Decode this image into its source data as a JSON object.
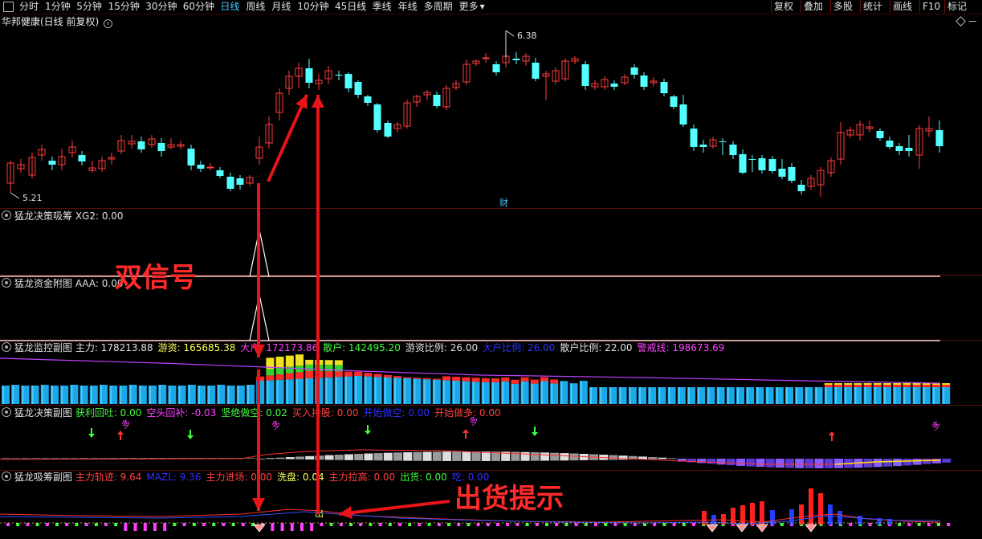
{
  "toolbar": {
    "left_tabs": [
      "分时",
      "1分钟",
      "5分钟",
      "15分钟",
      "30分钟",
      "60分钟",
      "日线",
      "周线",
      "月线",
      "10分钟",
      "45日线",
      "季线",
      "年线",
      "多周期",
      "更多"
    ],
    "active_tab": "日线",
    "right_buttons": [
      "复权",
      "叠加",
      "多股",
      "统计",
      "画线",
      "F10",
      "标记"
    ]
  },
  "main_panel": {
    "title": "华邦健康(日线 前复权)",
    "high_label": "6.38",
    "low_label": "5.21",
    "fin_marker": "财"
  },
  "panels": {
    "p1": {
      "name": "猛龙决策吸筹",
      "items": [
        {
          "label": "XG2:",
          "value": "0.00",
          "color": "#e0e0e0"
        }
      ]
    },
    "p2": {
      "name": "猛龙资金附图",
      "items": [
        {
          "label": "AAA:",
          "value": "0.00",
          "color": "#e0e0e0"
        }
      ]
    },
    "p3": {
      "name": "猛龙监控副图",
      "items": [
        {
          "label": "主力:",
          "value": "178213.88",
          "color": "#e0e0e0"
        },
        {
          "label": "游资:",
          "value": "165685.38",
          "color": "#ffff60"
        },
        {
          "label": "大户:",
          "value": "172173.86",
          "color": "#ff40ff"
        },
        {
          "label": "散户:",
          "value": "142495.20",
          "color": "#40ff40"
        },
        {
          "label": "游资比例:",
          "value": "26.00",
          "color": "#e0e0e0"
        },
        {
          "label": "大户比例:",
          "value": "26.00",
          "color": "#3030ff"
        },
        {
          "label": "散户比例:",
          "value": "22.00",
          "color": "#e0e0e0"
        },
        {
          "label": "警戒线:",
          "value": "198673.69",
          "color": "#ff40ff"
        }
      ]
    },
    "p4": {
      "name": "猛龙决策副图",
      "items": [
        {
          "label": "获利回吐:",
          "value": "0.00",
          "color": "#40ff40"
        },
        {
          "label": "空头回补:",
          "value": "-0.03",
          "color": "#ff40ff"
        },
        {
          "label": "坚绝做空:",
          "value": "0.02",
          "color": "#40ff40"
        },
        {
          "label": "买入持股:",
          "value": "0.00",
          "color": "#ff4040"
        },
        {
          "label": "开始做空:",
          "value": "0.00",
          "color": "#3030ff"
        },
        {
          "label": "开始做多:",
          "value": "0.00",
          "color": "#ff4040"
        }
      ]
    },
    "p5": {
      "name": "猛龙吸筹副图",
      "items": [
        {
          "label": "主力轨迹:",
          "value": "9.64",
          "color": "#ff4040"
        },
        {
          "label": "MAZL:",
          "value": "9.36",
          "color": "#3030ff"
        },
        {
          "label": "主力进场:",
          "value": "0.00",
          "color": "#ff4040"
        },
        {
          "label": "洗盘:",
          "value": "0.04",
          "color": "#ffff60"
        },
        {
          "label": "主力拉高:",
          "value": "0.00",
          "color": "#ff4040"
        },
        {
          "label": "出货:",
          "value": "0.00",
          "color": "#40ff40"
        },
        {
          "label": "吃:",
          "value": "0.00",
          "color": "#3030ff"
        }
      ]
    }
  },
  "annotations": {
    "double_signal": "双信号",
    "ship_hint": "出货提示",
    "ship_char": "出",
    "sell_arrow_char": "多"
  },
  "colors": {
    "up": "#ff3c3c",
    "down": "#54ffff",
    "grid": "#5a0e0e",
    "accent": "#46c8ff"
  }
}
